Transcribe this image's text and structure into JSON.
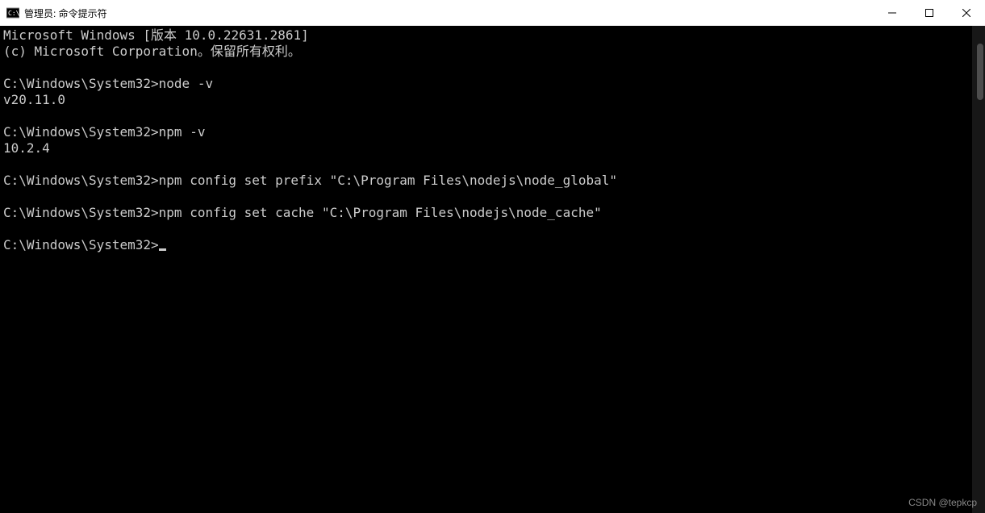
{
  "titlebar": {
    "title": "管理员: 命令提示符"
  },
  "terminal": {
    "lines": [
      "Microsoft Windows [版本 10.0.22631.2861]",
      "(c) Microsoft Corporation。保留所有权利。",
      "",
      "C:\\Windows\\System32>node -v",
      "v20.11.0",
      "",
      "C:\\Windows\\System32>npm -v",
      "10.2.4",
      "",
      "C:\\Windows\\System32>npm config set prefix \"C:\\Program Files\\nodejs\\node_global\"",
      "",
      "C:\\Windows\\System32>npm config set cache \"C:\\Program Files\\nodejs\\node_cache\"",
      ""
    ],
    "prompt": "C:\\Windows\\System32>"
  },
  "watermark": "CSDN @tepkcp"
}
